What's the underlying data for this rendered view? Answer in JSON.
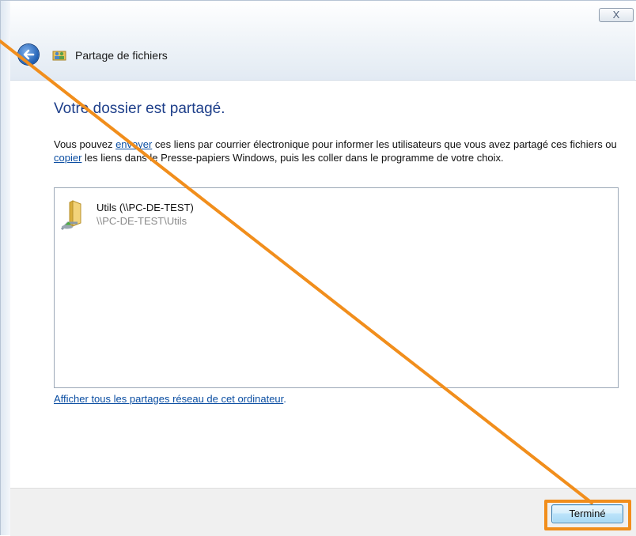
{
  "window": {
    "title": "Partage de fichiers",
    "close_label": "X"
  },
  "main": {
    "heading": "Votre dossier est partagé.",
    "description": {
      "part1": "Vous pouvez ",
      "link_send": "envoyer",
      "part2": " ces liens par courrier électronique pour informer les utilisateurs que vous avez partagé ces fichiers ou ",
      "link_copy": "copier",
      "part3": " les liens dans le Presse-papiers Windows, puis les coller dans le programme de votre choix."
    },
    "shares": [
      {
        "name": "Utils (\\\\PC-DE-TEST)",
        "path": "\\\\PC-DE-TEST\\Utils"
      }
    ],
    "show_all_link": "Afficher tous les partages réseau de cet ordinateur",
    "show_all_suffix": "."
  },
  "footer": {
    "done_label": "Terminé"
  },
  "colors": {
    "heading": "#1e3f8a",
    "link": "#0b4ea2",
    "highlight": "#f18e1c"
  },
  "icons": {
    "back": "back-arrow-icon",
    "app": "file-sharing-icon",
    "share": "shared-folder-icon"
  }
}
